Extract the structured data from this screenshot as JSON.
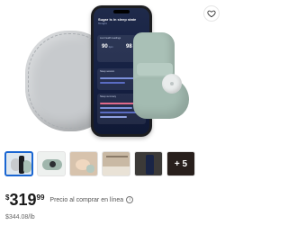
{
  "product": {
    "favorite_icon": "heart-outline-icon",
    "colors": {
      "sock": "#a9c0b6",
      "case": "#c7cacd",
      "phone_screen": "#152043",
      "selection": "#1a66d2"
    }
  },
  "phone_screen": {
    "title": "Sugar is in sleep state",
    "date": "Tonight",
    "card1_label": "Live health readings",
    "heart_rate": "90",
    "heart_rate_unit": "bpm",
    "oxygen": "98",
    "oxygen_unit": "%",
    "card2_label": "Sleep session",
    "card3_label": "Sleep summary"
  },
  "thumbnails": {
    "items": [
      {
        "name": "thumb-product-set",
        "bg": "#dfe7ee"
      },
      {
        "name": "thumb-sock-side",
        "bg": "#eef1ef"
      },
      {
        "name": "thumb-baby-sleeping",
        "bg": "#d7c3ad"
      },
      {
        "name": "thumb-nursery",
        "bg": "#c9b9a4"
      },
      {
        "name": "thumb-phone-app",
        "bg": "#3c3a38"
      },
      {
        "name": "thumb-more",
        "bg": "#4a3a33"
      }
    ],
    "more_label": "+ 5"
  },
  "price": {
    "currency": "$",
    "whole": "319",
    "cents": "99",
    "note": "Precio al comprar en línea",
    "info_icon": "i",
    "unit_price": "$344.08/lb"
  }
}
